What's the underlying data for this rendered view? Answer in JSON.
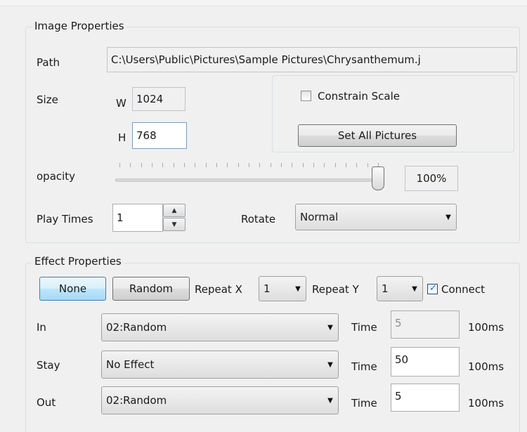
{
  "image_properties": {
    "title": "Image Properties",
    "path_label": "Path",
    "path_value": "C:\\Users\\Public\\Pictures\\Sample Pictures\\Chrysanthemum.j",
    "size_label": "Size",
    "w_label": "W",
    "w_value": "1024",
    "h_label": "H",
    "h_value": "768",
    "constrain_label": "Constrain Scale",
    "constrain_checked": false,
    "set_all_label": "Set All Pictures",
    "opacity_label": "opacity",
    "opacity_value": "100%",
    "opacity_level": 1.0,
    "play_times_label": "Play Times",
    "play_times_value": "1",
    "rotate_label": "Rotate",
    "rotate_value": "Normal"
  },
  "effect_properties": {
    "title": "Effect Properties",
    "none_label": "None",
    "random_label": "Random",
    "repeat_x_label": "Repeat X",
    "repeat_x_value": "1",
    "repeat_y_label": "Repeat Y",
    "repeat_y_value": "1",
    "connect_label": "Connect",
    "connect_checked": true,
    "time_label": "Time",
    "unit_label": "100ms",
    "rows": [
      {
        "label": "In",
        "effect": "02:Random",
        "time": "5"
      },
      {
        "label": "Stay",
        "effect": "No Effect",
        "time": "50"
      },
      {
        "label": "Out",
        "effect": "02:Random",
        "time": "5"
      }
    ]
  },
  "icons": {
    "dropdown": "chevron-down-icon",
    "spin_up": "spin-up-icon",
    "spin_down": "spin-down-icon",
    "check": "checkmark-icon",
    "slider": "slider-thumb-icon"
  },
  "colors": {
    "background": "#f0f0f0",
    "group_border": "#d5dfe5",
    "active_button": "#bee6fd",
    "check_mark": "#2b6fb7"
  }
}
